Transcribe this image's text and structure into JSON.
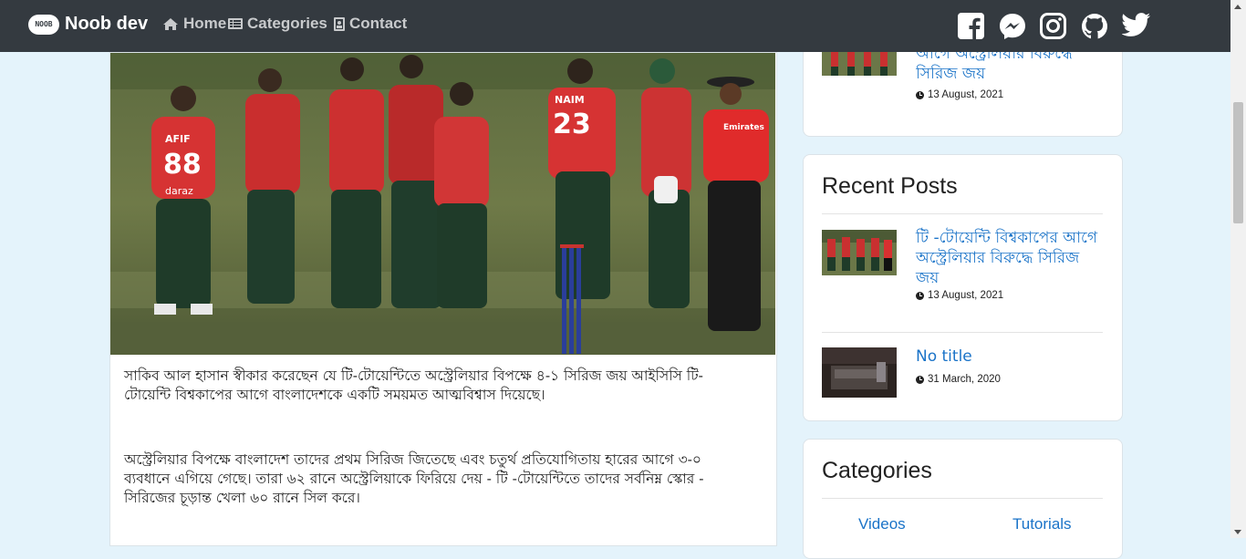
{
  "nav": {
    "brand_badge": "NOOB",
    "brand": "Noob dev",
    "items": [
      {
        "label": "Home",
        "icon": "home-icon"
      },
      {
        "label": "Categories",
        "icon": "list-icon"
      },
      {
        "label": "Contact",
        "icon": "contact-icon"
      }
    ],
    "social": [
      "facebook-icon",
      "messenger-icon",
      "instagram-icon",
      "github-icon",
      "twitter-icon"
    ]
  },
  "article": {
    "paragraphs": [
      "সাকিব আল হাসান স্বীকার করেছেন যে টি-টোয়েন্টিতে অস্ট্রেলিয়ার বিপক্ষে ৪-১ সিরিজ জয় আইসিসি টি-টোয়েন্টি বিশ্বকাপের আগে বাংলাদেশকে একটি সময়মত আত্মবিশ্বাস দিয়েছে।",
      "অস্ট্রেলিয়ার বিপক্ষে বাংলাদেশ তাদের প্রথম সিরিজ জিতেছে এবং চতুর্থ প্রতিযোগিতায় হারের আগে ৩-০ ব্যবধানে এগিয়ে গেছে। তারা ৬২  রানে অস্ট্রেলিয়াকে  ফিরিয়ে দেয় - টি -টোয়েন্টিতে তাদের সর্বনিম্ন স্কোর - সিরিজের চূড়ান্ত খেলা ৬০ রানে সিল করে।"
    ],
    "jersey_text": {
      "p1_name": "AFIF",
      "p1_num": "88",
      "p2_name": "NAIM",
      "p2_num": "23",
      "sponsor": "daraz",
      "umpire": "Emirates"
    }
  },
  "top_card": {
    "title_partial": "আগে অস্ট্রেলিয়ার বিরুদ্ধে সিরিজ জয়",
    "date": "13 August, 2021"
  },
  "recent_posts": {
    "title": "Recent Posts",
    "posts": [
      {
        "title": "টি -টোয়েন্টি বিশ্বকাপের আগে অস্ট্রেলিয়ার বিরুদ্ধে সিরিজ জয়",
        "date": "13 August, 2021"
      },
      {
        "title": "No title",
        "date": "31 March, 2020"
      }
    ]
  },
  "categories": {
    "title": "Categories",
    "items": [
      "Videos",
      "Tutorials"
    ]
  },
  "colors": {
    "navbar": "#343a40",
    "link": "#1a73c8",
    "page_bg": "#e4f3fb"
  }
}
